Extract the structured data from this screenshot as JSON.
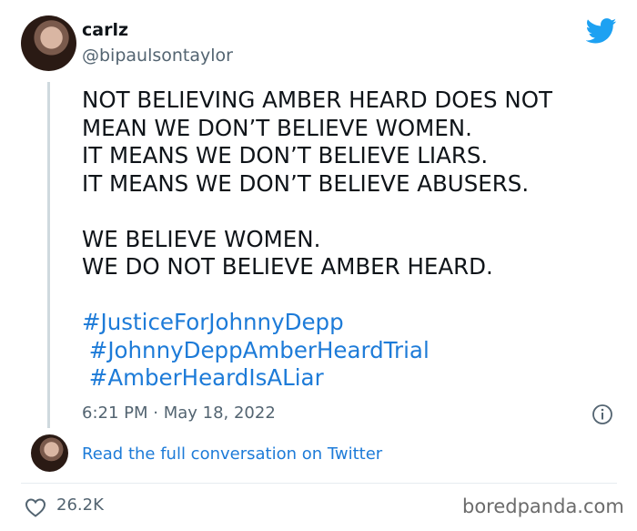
{
  "author": {
    "display_name": "carlz",
    "handle": "@bipaulsontaylor",
    "avatar": "profile-photo"
  },
  "tweet": {
    "text": "NOT BELIEVING AMBER HEARD DOES NOT\nMEAN WE DON’T BELIEVE WOMEN.\nIT MEANS WE DON’T BELIEVE LIARS.\nIT MEANS WE DON’T BELIEVE ABUSERS.\n\nWE BELIEVE WOMEN.\nWE DO NOT BELIEVE AMBER HEARD.",
    "hashtags": [
      "#JusticeForJohnnyDepp",
      " #JohnnyDeppAmberHeardTrial",
      " #AmberHeardIsALiar"
    ],
    "timestamp": "6:21 PM · May 18, 2022"
  },
  "footer": {
    "read_link": "Read the full conversation on Twitter",
    "likes": "26.2K",
    "watermark": "boredpanda.com"
  },
  "icons": {
    "brand": "twitter-bird-icon",
    "info": "info-icon",
    "like": "heart-icon"
  },
  "colors": {
    "link": "#1d7bd8",
    "muted": "#536471",
    "brand": "#1da1f2",
    "text": "#0f1419"
  }
}
